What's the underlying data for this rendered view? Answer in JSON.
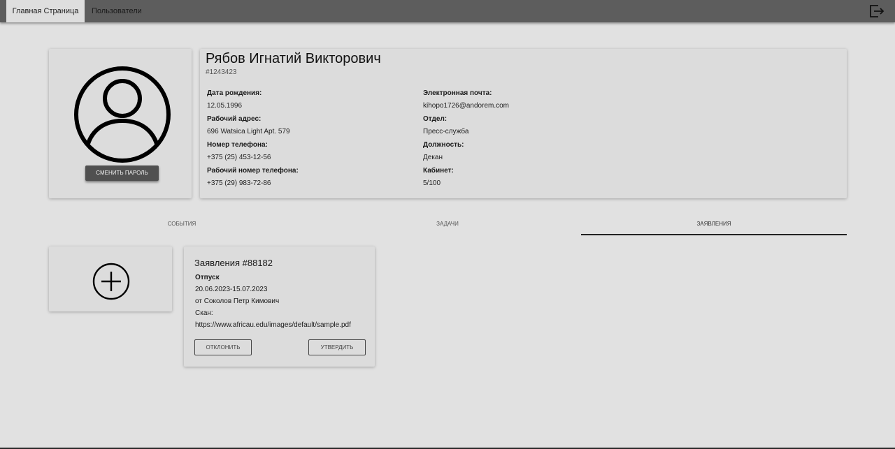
{
  "nav": {
    "tabs": [
      {
        "label": "Главная Страница",
        "active": true
      },
      {
        "label": "Пользователи",
        "active": false
      }
    ],
    "logout_icon": "logout-icon"
  },
  "profile": {
    "avatar_icon": "user-avatar-icon",
    "change_password_label": "Сменить пароль",
    "name": "Рябов Игнатий Викторович",
    "id": "#1243423",
    "left_fields": [
      {
        "label": "Дата рождения:",
        "value": "12.05.1996"
      },
      {
        "label": "Рабочий адрес:",
        "value": "696 Watsica Light Apt. 579"
      },
      {
        "label": "Номер телефона:",
        "value": "+375 (25) 453-12-56"
      },
      {
        "label": "Рабочий номер телефона:",
        "value": "+375 (29) 983-72-86"
      }
    ],
    "right_fields": [
      {
        "label": "Электронная почта:",
        "value": "kihopo1726@andorem.com"
      },
      {
        "label": "Отдел:",
        "value": "Пресс-служба"
      },
      {
        "label": "Должность:",
        "value": "Декан"
      },
      {
        "label": "Кабинет:",
        "value": "5/100"
      }
    ]
  },
  "tabs": [
    {
      "label": "События",
      "active": false
    },
    {
      "label": "Задачи",
      "active": false
    },
    {
      "label": "Заявления",
      "active": true
    }
  ],
  "add_icon": "plus-circle-icon",
  "application": {
    "title": "Заявления #88182",
    "type": "Отпуск",
    "dates": "20.06.2023-15.07.2023",
    "from": "от Соколов Петр Кимович",
    "scan_label": "Скан:",
    "scan_link": "https://www.africau.edu/images/default/sample.pdf",
    "reject_label": "Отклонить",
    "approve_label": "Утвердить"
  },
  "colors": {
    "background": "#e1e1e1",
    "topbar": "#5d5d5d",
    "button_dark": "#505050"
  }
}
